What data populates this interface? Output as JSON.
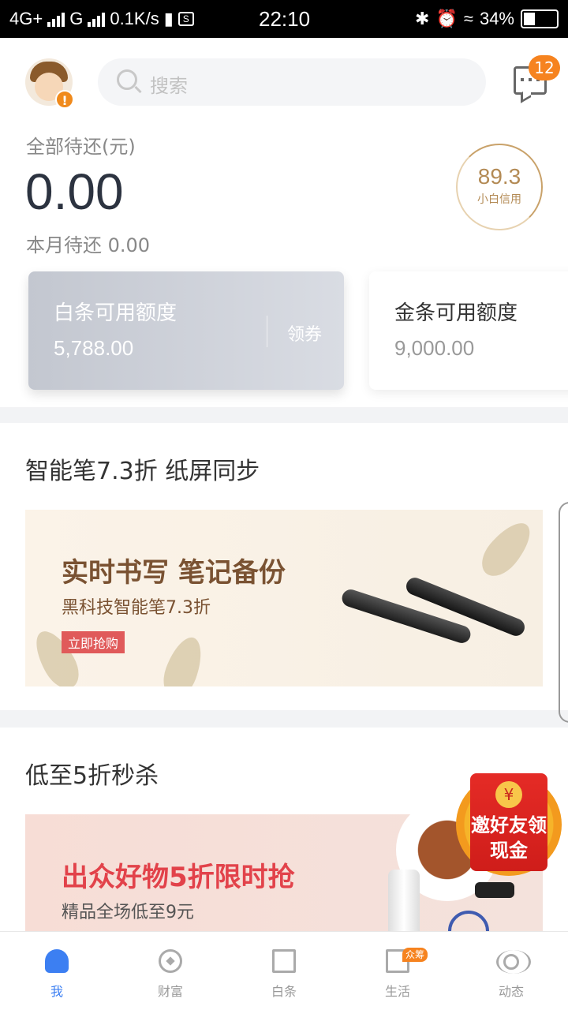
{
  "statusbar": {
    "network": "4G+",
    "carrier2": "G",
    "speed": "0.1K/s",
    "time": "22:10",
    "battery": "34%"
  },
  "header": {
    "search_placeholder": "搜索",
    "message_count": "12"
  },
  "summary": {
    "total_label": "全部待还(元)",
    "total_amount": "0.00",
    "month_label": "本月待还 0.00",
    "credit_score": "89.3",
    "credit_label": "小白信用"
  },
  "cards": {
    "baitiao": {
      "title": "白条可用额度",
      "value": "5,788.00",
      "action": "领券"
    },
    "jintiao": {
      "title": "金条可用额度",
      "value": "9,000.00"
    }
  },
  "section1": {
    "title": "智能笔7.3折 纸屏同步",
    "banner_heading": "实时书写 笔记备份",
    "banner_sub": "黑科技智能笔7.3折",
    "banner_button": "立即抢购"
  },
  "section2": {
    "title": "低至5折秒杀",
    "banner_heading": "出众好物5折限时抢",
    "banner_sub": "精品全场低至9元"
  },
  "floating": {
    "coin": "¥",
    "text": "邀好友领现金"
  },
  "tabs": {
    "me": "我",
    "wealth": "财富",
    "baitiao": "白条",
    "life": "生活",
    "life_badge": "众筹",
    "dynamic": "动态"
  },
  "colors": {
    "accent": "#3c7ff2",
    "badge": "#f6831f",
    "credit_gold": "#b38a54",
    "promo_red": "#e2424a"
  }
}
